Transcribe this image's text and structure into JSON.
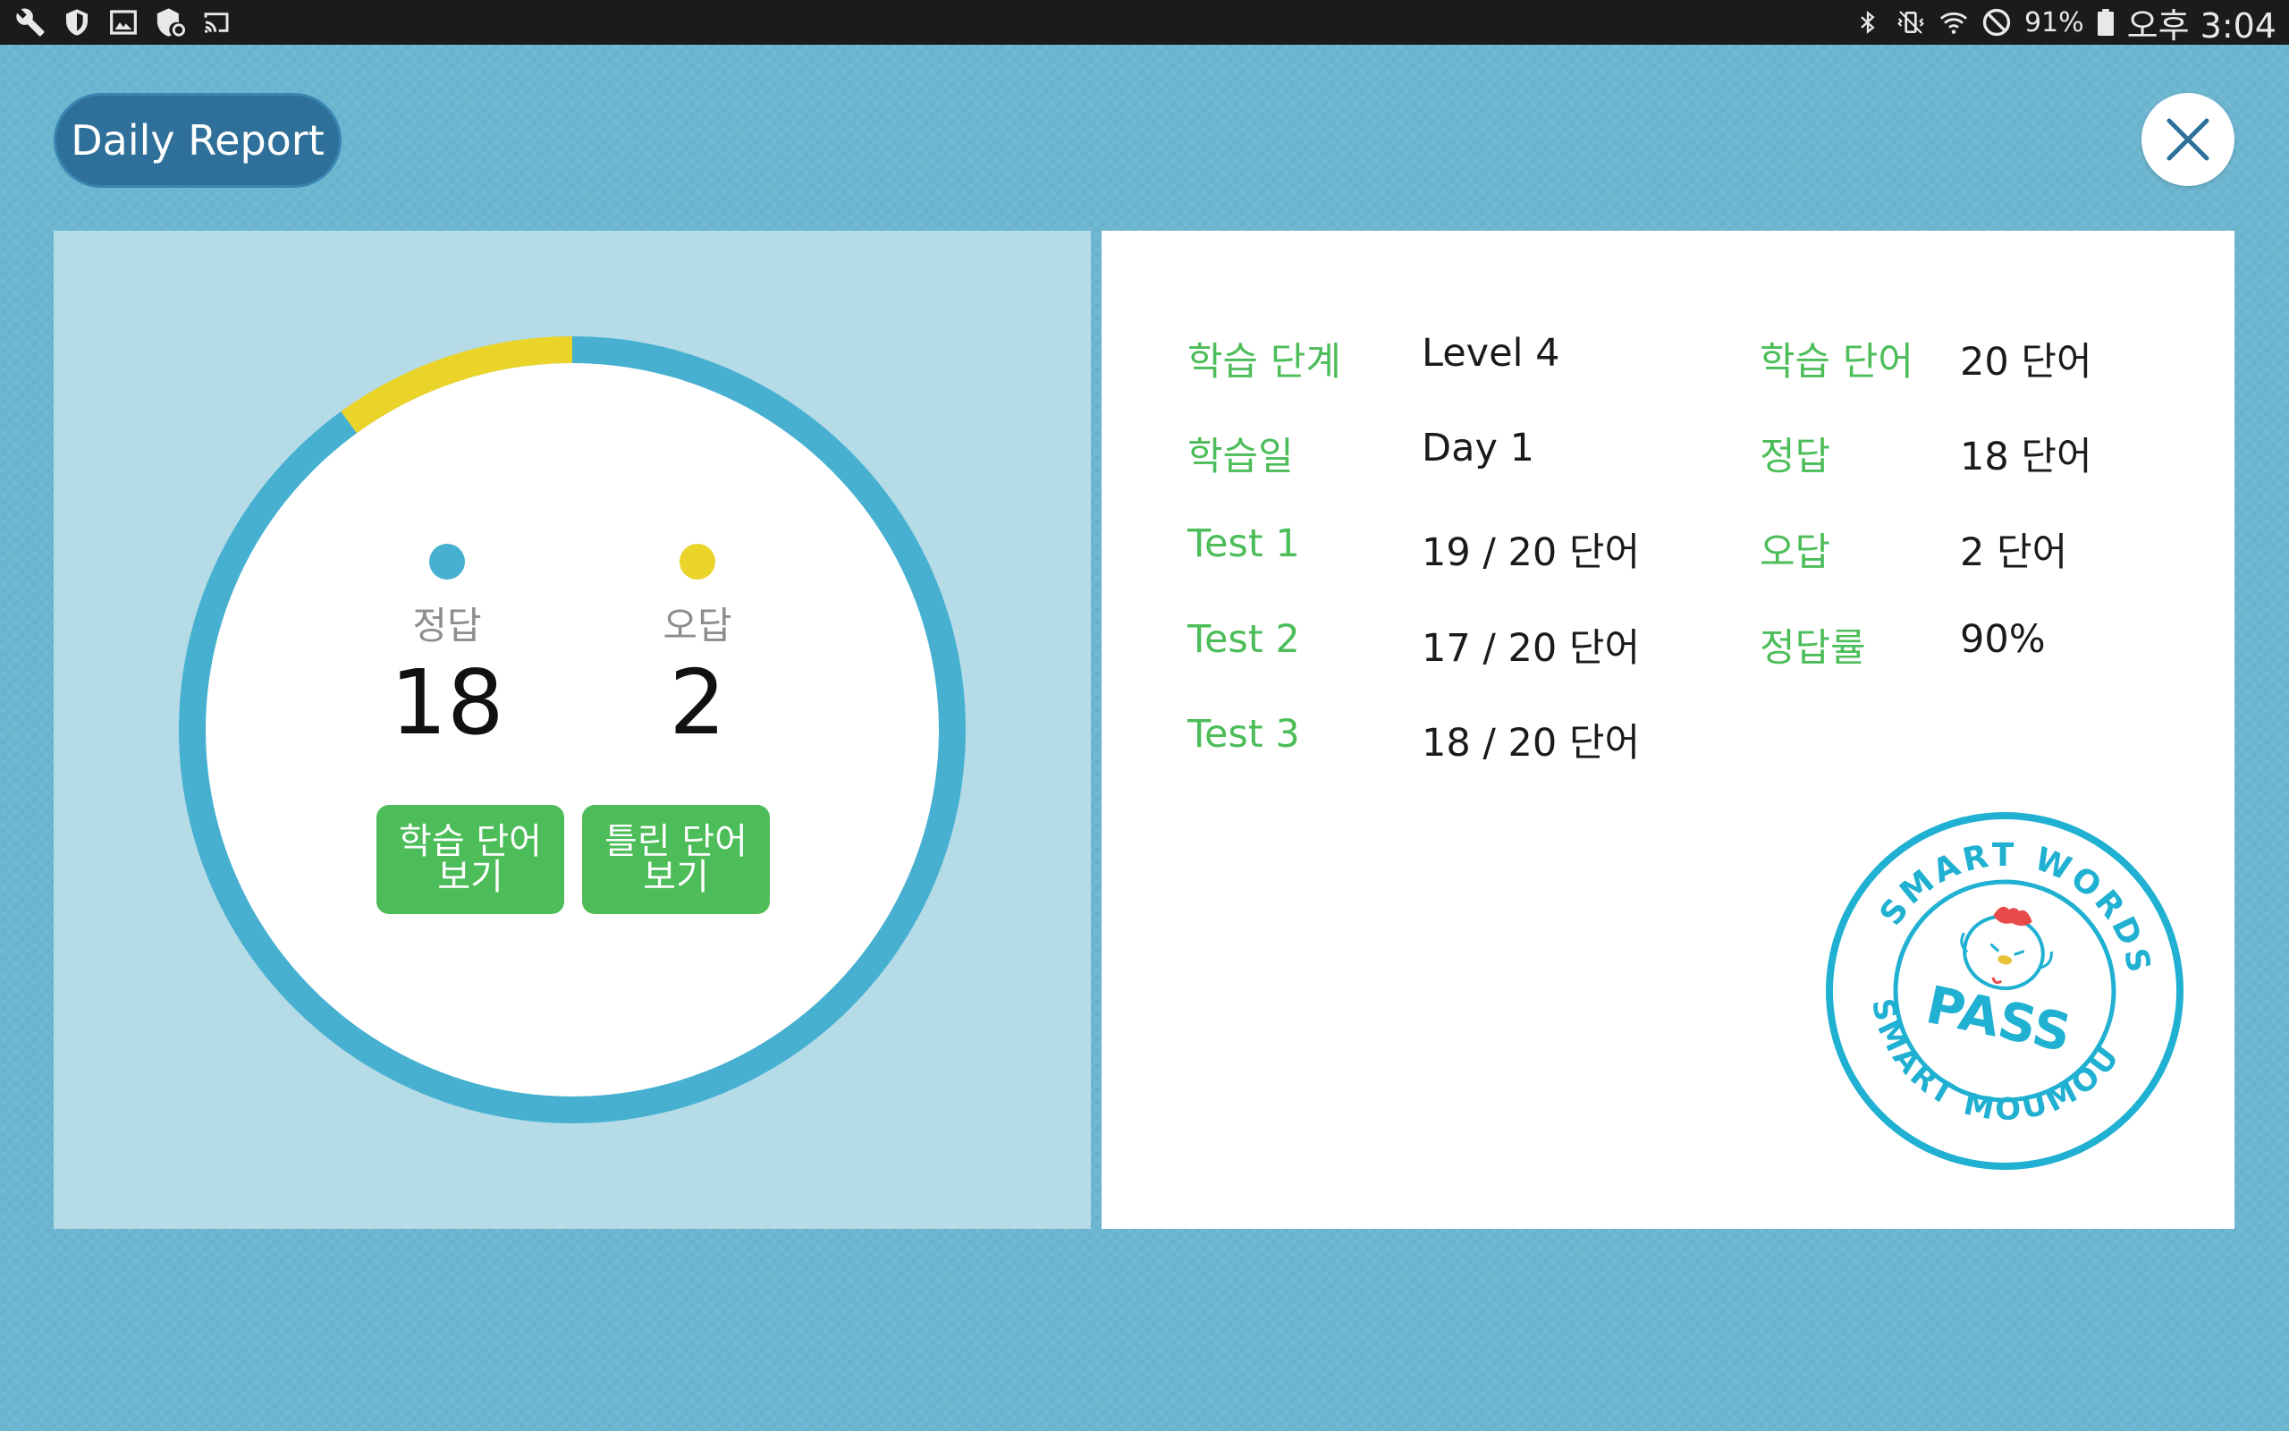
{
  "status_bar": {
    "left_icons": [
      "wrench-icon",
      "shield-icon",
      "image-icon",
      "shield-refresh-icon",
      "cast-icon"
    ],
    "right_icons": [
      "bluetooth-icon",
      "vibrate-off-icon",
      "wifi-icon",
      "do-not-disturb-icon",
      "battery-icon"
    ],
    "battery": "91%",
    "time": "오후 3:04"
  },
  "header": {
    "title": "Daily Report",
    "close_icon": "close-icon"
  },
  "summary": {
    "correct_label": "정답",
    "correct_count": "18",
    "wrong_label": "오답",
    "wrong_count": "2",
    "btn_study_line1": "학습 단어",
    "btn_study_line2": "보기",
    "btn_wrong_line1": "틀린 단어",
    "btn_wrong_line2": "보기"
  },
  "chart_data": {
    "type": "pie",
    "categories": [
      "정답",
      "오답"
    ],
    "values": [
      18,
      2
    ],
    "colors": [
      "#47b0d1",
      "#ead42a"
    ]
  },
  "details": {
    "left": [
      {
        "label": "학습 단계",
        "value": "Level 4"
      },
      {
        "label": "학습일",
        "value": "Day 1"
      },
      {
        "label": "Test 1",
        "value": "19 / 20 단어"
      },
      {
        "label": "Test 2",
        "value": "17 / 20 단어"
      },
      {
        "label": "Test 3",
        "value": "18 / 20 단어"
      }
    ],
    "right": [
      {
        "label": "학습 단어",
        "value": "20 단어"
      },
      {
        "label": "정답",
        "value": "18 단어"
      },
      {
        "label": "오답",
        "value": "2 단어"
      },
      {
        "label": "정답률",
        "value": "90%"
      }
    ]
  },
  "stamp": {
    "top_text": "SMART WORDS",
    "center_text": "PASS",
    "bottom_text": "SMART MOUMOU",
    "color": "#1fb0d2"
  },
  "colors": {
    "background": "#6cb6d1",
    "pill": "#2e7099",
    "green": "#4cbd59",
    "correct": "#47b0d1",
    "wrong": "#ead42a"
  }
}
